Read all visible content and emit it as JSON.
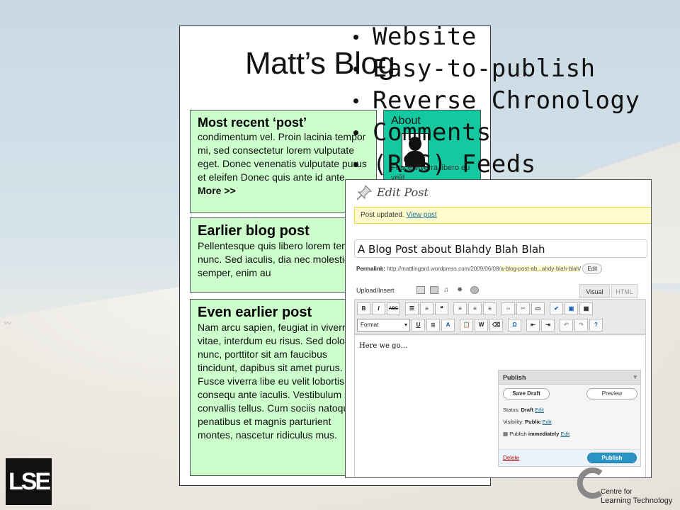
{
  "blog": {
    "title": "Matt’s Blog",
    "posts": [
      {
        "heading": "Most recent ‘post’",
        "body": "condimentum vel. Proin lacinia tempor mi, sed consectetur lorem vulputate eget. Donec venenatis vulputate purus et eleifen Donec quis ante id ante ",
        "more": "More >>"
      },
      {
        "heading": "Earlier blog post",
        "body": "Pellentesque quis libero lorem tempus nunc. Sed iaculis, dia nec molestie semper, enim au"
      },
      {
        "heading": "Even earlier post",
        "body": "Nam arcu sapien, feugiat in viverra vitae, interdum eu risus. Sed dolor nunc, porttitor sit am faucibus tincidunt, dapibus sit amet purus. Fusce viverra libe eu velit lobortis quis consequ ante iaculis. Vestibulum sed convallis tellus. Cum sociis natoque penatibus et magnis parturient montes, nascetur ridiculus mus."
      }
    ],
    "about": {
      "label": "About",
      "text": "Fusce viverra libero eu velit"
    }
  },
  "bullets": [
    "Website",
    "Easy-to-publish",
    "Reverse Chronology",
    "Comments",
    "(RSS) Feeds"
  ],
  "editor": {
    "page_title": "Edit Post",
    "notice_text": "Post updated.",
    "notice_link": "View post",
    "post_title": "A Blog Post about Blahdy Blah Blah",
    "permalink_label": "Permalink:",
    "permalink_base": "http://mattlingard.wordpress.com/2009/06/08/",
    "permalink_slug": "a-blog-post-ab...ahdy-blah-blah",
    "permalink_end": "/",
    "permalink_edit": "Edit",
    "upload_label": "Upload/Insert",
    "tab_visual": "Visual",
    "tab_html": "HTML",
    "format_select": "Format",
    "content": "Here we go...",
    "publish": {
      "title": "Publish",
      "save_draft": "Save Draft",
      "preview": "Preview",
      "status_label": "Status:",
      "status_value": "Draft",
      "visibility_label": "Visibility:",
      "visibility_value": "Public",
      "publish_label": "Publish",
      "publish_value": "immediately",
      "edit": "Edit",
      "delete": "Delete",
      "publish_button": "Publish"
    }
  },
  "logos": {
    "lse": "LSE",
    "clt_line1": "Centre for",
    "clt_line2": "Learning Technology"
  },
  "colors": {
    "post_bg": "#ccffcc",
    "about_bg": "#14c9a0",
    "wp_link": "#21759b",
    "publish_button": "#2a95c5"
  }
}
